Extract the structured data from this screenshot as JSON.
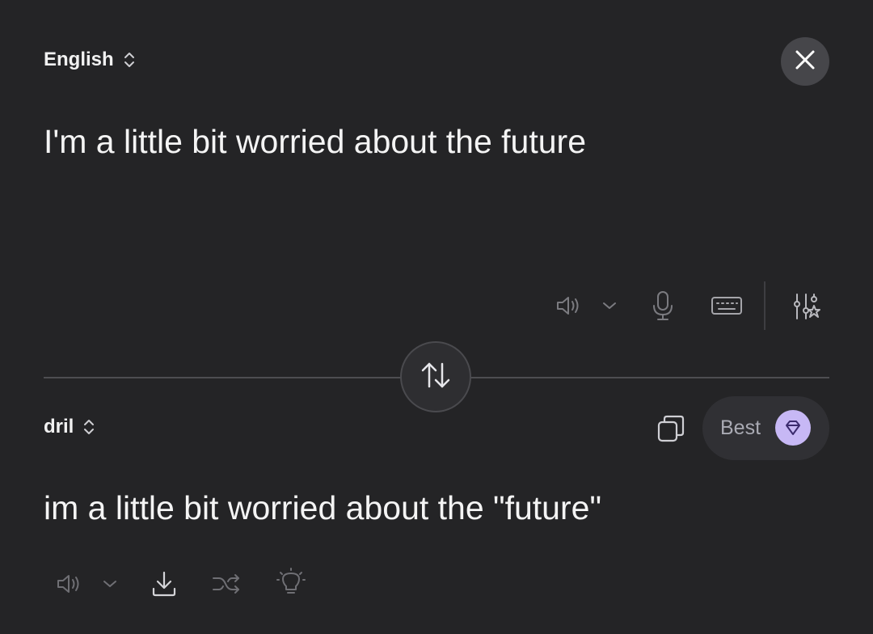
{
  "source": {
    "language": "English",
    "text": "I'm a little bit worried about the future"
  },
  "target": {
    "language": "dril",
    "text": "im a little bit worried about the \"future\"",
    "mode_label": "Best"
  },
  "icons": {
    "close": "close-icon",
    "swap": "swap-arrows-icon",
    "speaker": "speaker-icon",
    "mic": "microphone-icon",
    "keyboard": "keyboard-icon",
    "settings": "sliders-star-icon",
    "copy": "copy-icon",
    "gem": "gem-icon",
    "download": "download-icon",
    "shuffle": "shuffle-icon",
    "idea": "lightbulb-icon"
  },
  "colors": {
    "background": "#242426",
    "accent": "#c7b8f5"
  }
}
